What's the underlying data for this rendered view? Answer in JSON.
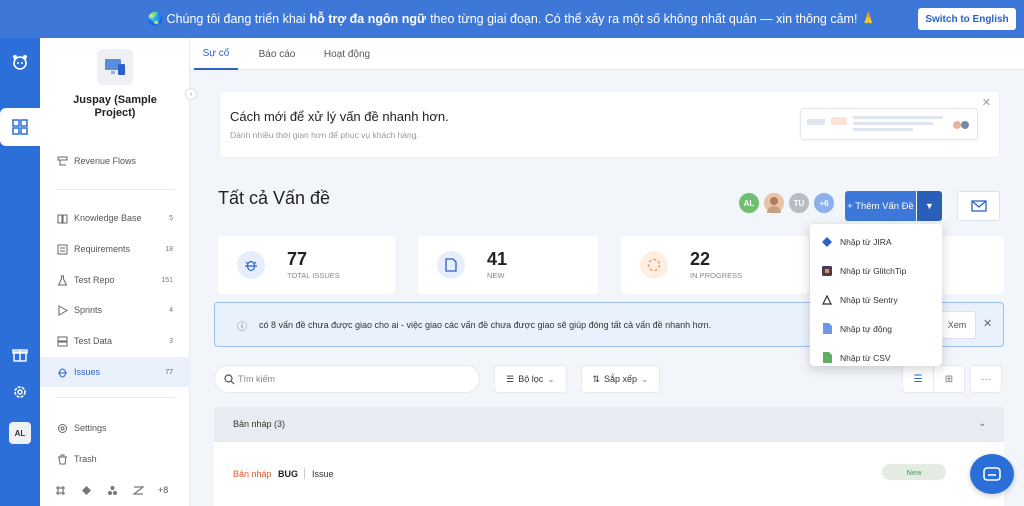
{
  "banner": {
    "prefix": "🌏 Chúng tôi đang triển khai",
    "bold": "hỗ trợ đa ngôn ngữ",
    "suffix": "theo từng giai đoạn. Có thể xảy ra một số không nhất quán — xin thông cảm! 🙏",
    "switch_label": "Switch to English"
  },
  "rail": {
    "user_initials": "AL"
  },
  "sidebar": {
    "project_name": "Juspay (Sample Project)",
    "items": [
      {
        "label": "Revenue Flows",
        "count": ""
      },
      {
        "label": "Knowledge Base",
        "count": "5"
      },
      {
        "label": "Requirements",
        "count": "18"
      },
      {
        "label": "Test Repo",
        "count": "151"
      },
      {
        "label": "Sprints",
        "count": "4"
      },
      {
        "label": "Test Data",
        "count": "3"
      },
      {
        "label": "Issues",
        "count": "77"
      },
      {
        "label": "Settings",
        "count": ""
      },
      {
        "label": "Trash",
        "count": ""
      }
    ],
    "integrations_more": "+8"
  },
  "tabs": [
    "Sự cố",
    "Báo cáo",
    "Hoạt động"
  ],
  "promo": {
    "title": "Cách mới để xử lý vấn đề nhanh hơn.",
    "subtitle": "Dành nhiều thời gian hơn để phục vụ khách hàng."
  },
  "header": {
    "title": "Tất cả Vấn đề",
    "avatars": [
      "AL",
      "",
      "TU",
      "+6"
    ],
    "add_label": "+ Thêm Vấn Đề"
  },
  "stats": [
    {
      "value": "77",
      "label": "TOTAL ISSUES"
    },
    {
      "value": "41",
      "label": "NEW"
    },
    {
      "value": "22",
      "label": "IN PROGRESS"
    }
  ],
  "info": {
    "text": "có 8 vấn đề chưa được giao cho ai - việc giao các vấn đề chưa được giao sẽ giúp đóng tất cả vấn đề nhanh hơn.",
    "view_label": "Xem"
  },
  "toolbar": {
    "search_placeholder": "Tìm kiếm",
    "filter_label": "Bộ lọc",
    "sort_label": "Sắp xếp"
  },
  "group": {
    "label": "Bản nháp (3)"
  },
  "row": {
    "status": "Bản nháp",
    "type": "BUG",
    "title": "Issue",
    "badge": "New"
  },
  "dropdown": [
    "Nhập từ JIRA",
    "Nhập từ GlitchTip",
    "Nhập từ Sentry",
    "Nhập tự động",
    "Nhập từ CSV"
  ],
  "colors": {
    "primary": "#3d78d8",
    "rail": "#2c6fd8",
    "draft": "#e4572e",
    "new_badge": "#3e9f5a"
  }
}
